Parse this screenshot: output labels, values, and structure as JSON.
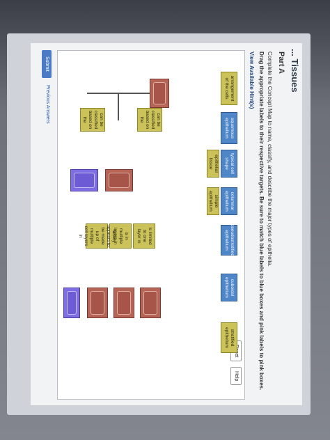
{
  "header": {
    "title": "... Tissues"
  },
  "part": {
    "label": "Part A"
  },
  "instructions": {
    "line1": "Complete the Concept Map to name, classify, and describe the major types of epithelia.",
    "line2": "Drag the appropriate labels to their respective targets. Be sure to match blue labels to blue boxes and pink labels to pink boxes."
  },
  "hints_link": "View Available Hint(s)",
  "toolbar": {
    "reset": "Reset",
    "help": "Help"
  },
  "labels": {
    "arrangement": "arrangement of the cells",
    "squamous": "squamous epithelium",
    "typical_shape": "typical cell shape",
    "epithelial_tissue": "epithelial tissue",
    "columnar": "columnar epithelium",
    "simple": "simple epithelium",
    "pseudostratified": "pseudostratified epithelium",
    "cuboidal": "cuboidal epithelium",
    "stratified": "stratified epithelium",
    "classified_on_1": "can be classified based on the",
    "classified_on_2": "can be classified based on the",
    "limited_one_layer_1": "is limited to one layer in",
    "multiple_layers_1": "is in multiple layers in",
    "falsely_appears": "falsely appears to be made up of multiple cell layers in",
    "limited_one_layer_2": "is limited to one layer in",
    "multiple_layers_2": "is in multiple layers in",
    "falsely_appears_2": "falsely appears to be made up of multiple cell layers in"
  },
  "footer": {
    "submit": "Submit",
    "previous": "Previous Answers"
  }
}
